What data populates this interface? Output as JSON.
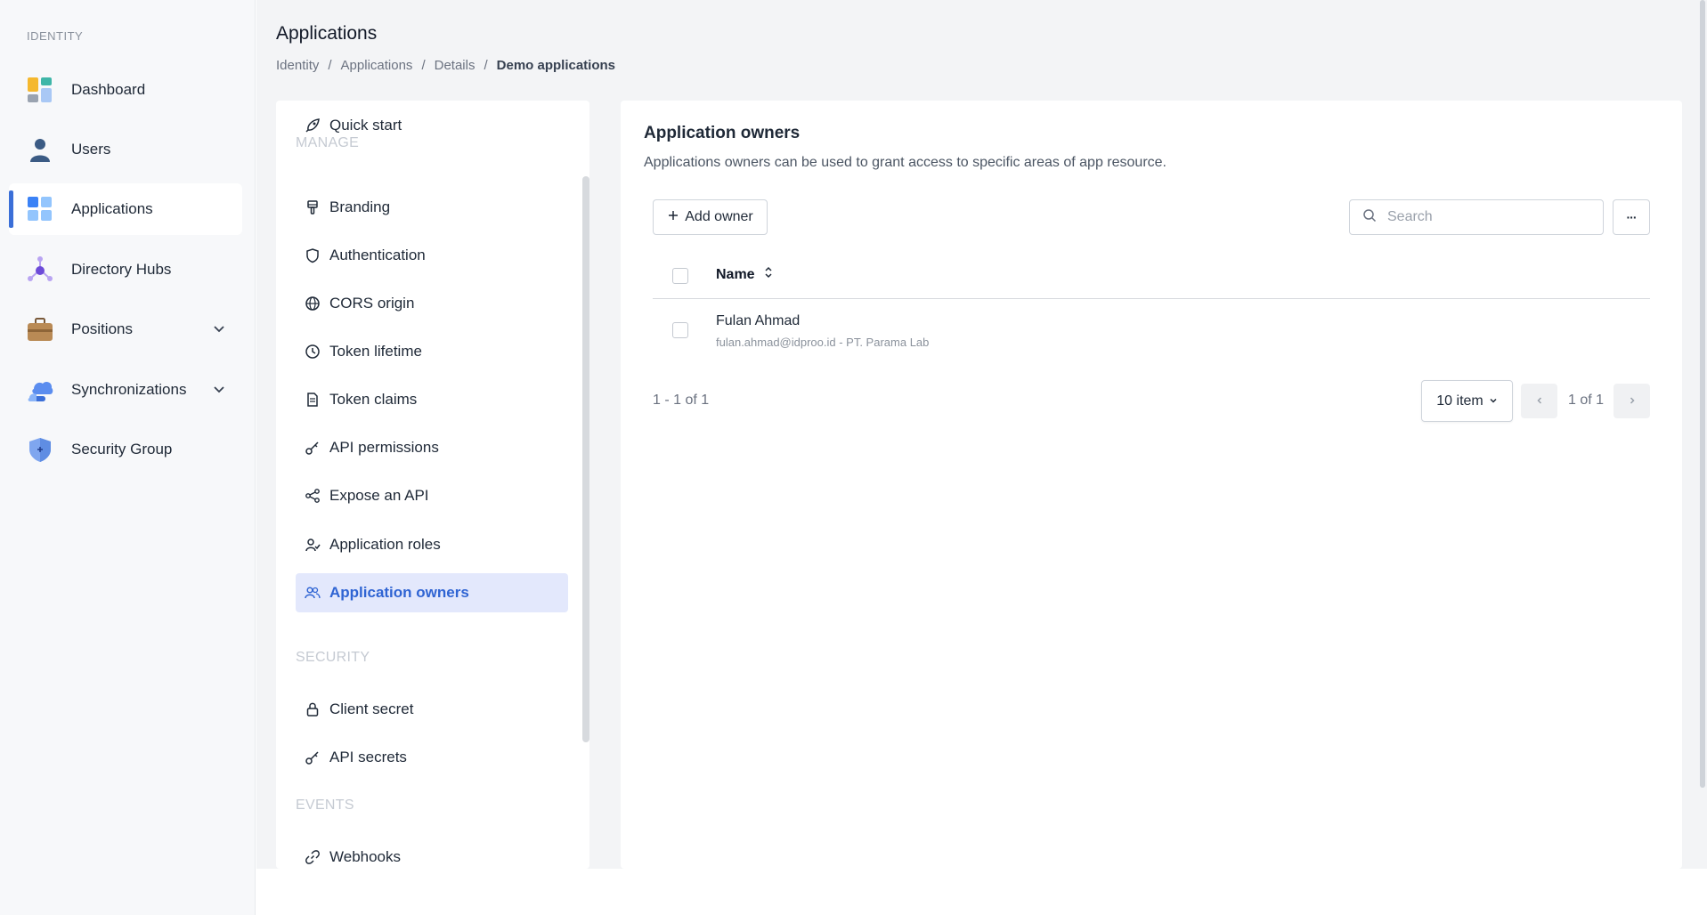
{
  "sidebar": {
    "section_label": "IDENTITY",
    "items": [
      {
        "label": "Dashboard",
        "icon": "dashboard-icon"
      },
      {
        "label": "Users",
        "icon": "user-icon"
      },
      {
        "label": "Applications",
        "icon": "applications-icon",
        "active": true
      },
      {
        "label": "Directory Hubs",
        "icon": "directory-hub-icon"
      },
      {
        "label": "Positions",
        "icon": "briefcase-icon",
        "expandable": true
      },
      {
        "label": "Synchronizations",
        "icon": "cloud-sync-icon",
        "expandable": true
      },
      {
        "label": "Security Group",
        "icon": "shield-icon"
      }
    ]
  },
  "header": {
    "title": "Applications",
    "breadcrumb": [
      "Identity",
      "Applications",
      "Details",
      "Demo applications"
    ],
    "breadcrumb_separator": "/"
  },
  "submenu": {
    "quick_start": "Quick start",
    "sections": {
      "manage": "MANAGE",
      "security": "SECURITY",
      "events": "EVENTS"
    },
    "items": {
      "branding": "Branding",
      "authentication": "Authentication",
      "cors": "CORS origin",
      "token_lifetime": "Token lifetime",
      "token_claims": "Token claims",
      "api_permissions": "API permissions",
      "expose_api": "Expose an API",
      "app_roles": "Application roles",
      "app_owners": "Application owners",
      "client_secret": "Client secret",
      "api_secrets": "API secrets",
      "webhooks": "Webhooks"
    },
    "active": "app_owners"
  },
  "content": {
    "title": "Application owners",
    "description": "Applications owners can be used to grant access to specific areas of app resource.",
    "add_button": "Add owner",
    "search_placeholder": "Search",
    "more_label": "···",
    "columns": [
      "Name"
    ],
    "rows": [
      {
        "name": "Fulan Ahmad",
        "subtitle": "fulan.ahmad@idproo.id - PT. Parama Lab"
      }
    ],
    "pagination": {
      "range": "1 - 1 of 1",
      "page_size": "10 item",
      "page": "1 of 1"
    }
  },
  "colors": {
    "accent": "#3b6fd8",
    "active_bg": "#e3e8fc",
    "page_bg": "#f3f4f6"
  }
}
